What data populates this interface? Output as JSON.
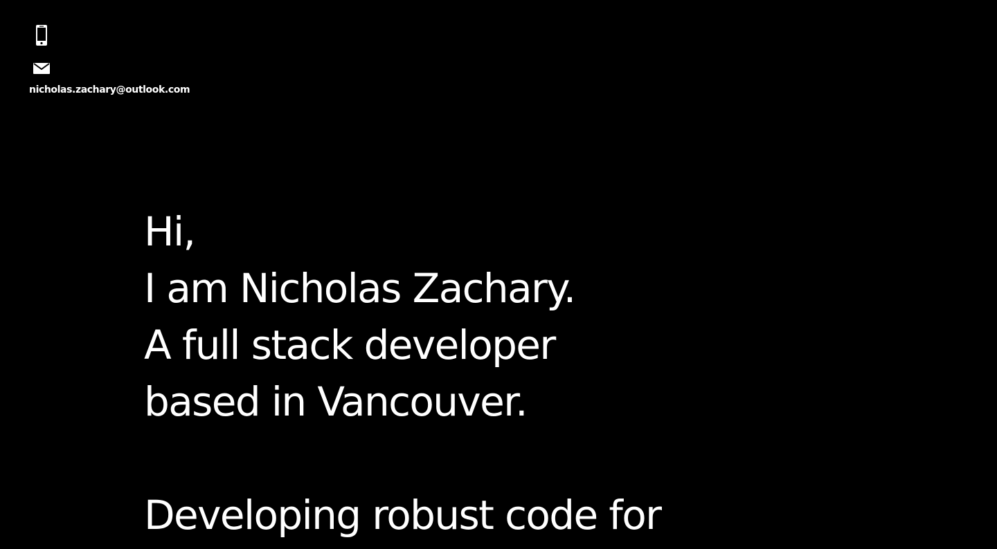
{
  "contact": {
    "phone_icon": "phone-icon",
    "mail_icon": "envelope-icon",
    "email": "nicholas.zachary@outlook.com"
  },
  "hero": {
    "greeting": "Hi,",
    "name_line": "I am Nicholas Zachary.",
    "role_line": "A full stack developer",
    "location_line": "based in Vancouver.",
    "tagline": "Developing robust code for"
  },
  "colors": {
    "background": "#000000",
    "text": "#ffffff"
  }
}
